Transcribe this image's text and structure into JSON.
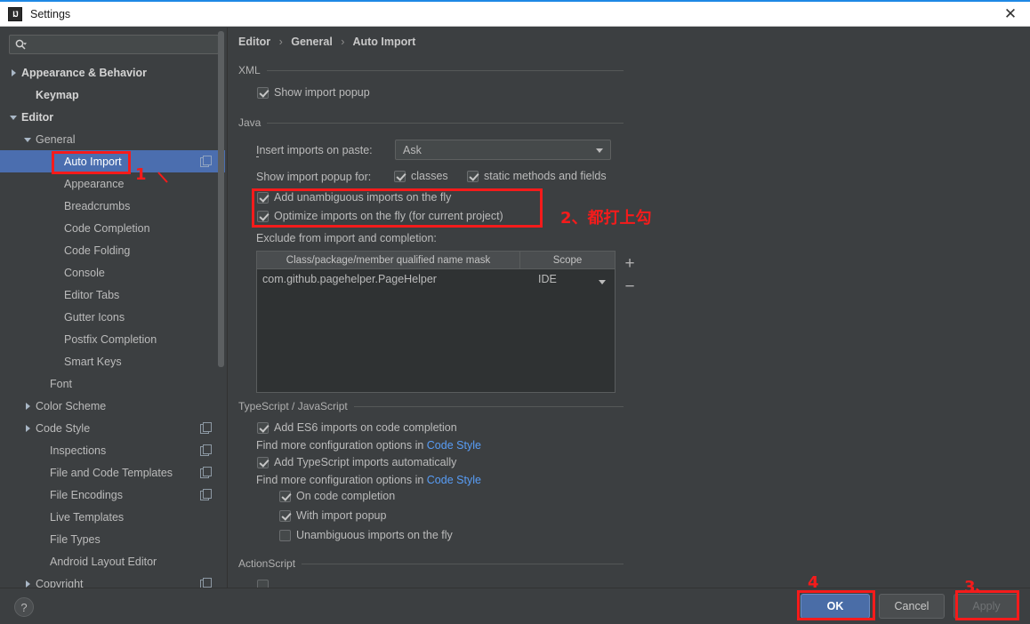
{
  "window": {
    "title": "Settings",
    "app_icon": "intellij-idea-icon",
    "close_label": "✕",
    "accent_color": "#1e88e5"
  },
  "sidebar": {
    "search": {
      "value": "",
      "placeholder": "",
      "icon": "search-icon"
    },
    "items": [
      {
        "label": "Appearance & Behavior",
        "indent": 0,
        "arrow": "right",
        "bold": true,
        "selected": false,
        "copy": false
      },
      {
        "label": "Keymap",
        "indent": 1,
        "arrow": "none",
        "bold": true,
        "selected": false,
        "copy": false
      },
      {
        "label": "Editor",
        "indent": 0,
        "arrow": "down",
        "bold": true,
        "selected": false,
        "copy": false
      },
      {
        "label": "General",
        "indent": 1,
        "arrow": "down",
        "bold": false,
        "selected": false,
        "copy": false
      },
      {
        "label": "Auto Import",
        "indent": 3,
        "arrow": "none",
        "bold": false,
        "selected": true,
        "copy": true
      },
      {
        "label": "Appearance",
        "indent": 3,
        "arrow": "none",
        "bold": false,
        "selected": false,
        "copy": false
      },
      {
        "label": "Breadcrumbs",
        "indent": 3,
        "arrow": "none",
        "bold": false,
        "selected": false,
        "copy": false
      },
      {
        "label": "Code Completion",
        "indent": 3,
        "arrow": "none",
        "bold": false,
        "selected": false,
        "copy": false
      },
      {
        "label": "Code Folding",
        "indent": 3,
        "arrow": "none",
        "bold": false,
        "selected": false,
        "copy": false
      },
      {
        "label": "Console",
        "indent": 3,
        "arrow": "none",
        "bold": false,
        "selected": false,
        "copy": false
      },
      {
        "label": "Editor Tabs",
        "indent": 3,
        "arrow": "none",
        "bold": false,
        "selected": false,
        "copy": false
      },
      {
        "label": "Gutter Icons",
        "indent": 3,
        "arrow": "none",
        "bold": false,
        "selected": false,
        "copy": false
      },
      {
        "label": "Postfix Completion",
        "indent": 3,
        "arrow": "none",
        "bold": false,
        "selected": false,
        "copy": false
      },
      {
        "label": "Smart Keys",
        "indent": 3,
        "arrow": "none",
        "bold": false,
        "selected": false,
        "copy": false
      },
      {
        "label": "Font",
        "indent": 2,
        "arrow": "none",
        "bold": false,
        "selected": false,
        "copy": false
      },
      {
        "label": "Color Scheme",
        "indent": 1,
        "arrow": "right",
        "bold": false,
        "selected": false,
        "copy": false
      },
      {
        "label": "Code Style",
        "indent": 1,
        "arrow": "right",
        "bold": false,
        "selected": false,
        "copy": true
      },
      {
        "label": "Inspections",
        "indent": 2,
        "arrow": "none",
        "bold": false,
        "selected": false,
        "copy": true
      },
      {
        "label": "File and Code Templates",
        "indent": 2,
        "arrow": "none",
        "bold": false,
        "selected": false,
        "copy": true
      },
      {
        "label": "File Encodings",
        "indent": 2,
        "arrow": "none",
        "bold": false,
        "selected": false,
        "copy": true
      },
      {
        "label": "Live Templates",
        "indent": 2,
        "arrow": "none",
        "bold": false,
        "selected": false,
        "copy": false
      },
      {
        "label": "File Types",
        "indent": 2,
        "arrow": "none",
        "bold": false,
        "selected": false,
        "copy": false
      },
      {
        "label": "Android Layout Editor",
        "indent": 2,
        "arrow": "none",
        "bold": false,
        "selected": false,
        "copy": false
      },
      {
        "label": "Copyright",
        "indent": 1,
        "arrow": "right",
        "bold": false,
        "selected": false,
        "copy": true
      }
    ]
  },
  "breadcrumb": {
    "part1": "Editor",
    "part2": "General",
    "part3": "Auto Import",
    "separator": "›"
  },
  "xml_section": {
    "title": "XML",
    "show_import_popup": {
      "label": "Show import popup",
      "checked": true
    }
  },
  "java_section": {
    "title": "Java",
    "insert_imports_label": "Insert imports on paste:",
    "insert_imports_value": "Ask",
    "show_popup_for_label": "Show import popup for:",
    "classes": {
      "label": "classes",
      "checked": true
    },
    "static_methods": {
      "label": "static methods and fields",
      "checked": true
    },
    "add_unambiguous": {
      "label": "Add unambiguous imports on the fly",
      "checked": true
    },
    "optimize_imports": {
      "label": "Optimize imports on the fly (for current project)",
      "checked": true
    },
    "exclude_label": "Exclude from import and completion:",
    "table": {
      "headers": [
        "Class/package/member qualified name mask",
        "Scope"
      ],
      "rows": [
        {
          "mask": "com.github.pagehelper.PageHelper",
          "scope": "IDE"
        }
      ],
      "add_button": "+",
      "remove_button": "−"
    }
  },
  "ts_section": {
    "title": "TypeScript / JavaScript",
    "add_es6": {
      "label": "Add ES6 imports on code completion",
      "checked": true
    },
    "hint1_prefix": "Find more configuration options in ",
    "hint1_link": "Code Style",
    "add_ts": {
      "label": "Add TypeScript imports automatically",
      "checked": true
    },
    "hint2_prefix": "Find more configuration options in ",
    "hint2_link": "Code Style",
    "on_code_completion": {
      "label": "On code completion",
      "checked": true
    },
    "with_import_popup": {
      "label": "With import popup",
      "checked": true
    },
    "unambiguous_fly": {
      "label": "Unambiguous imports on the fly",
      "checked": false
    }
  },
  "actionscript_section": {
    "title": "ActionScript"
  },
  "footer": {
    "help": "?",
    "ok": "OK",
    "cancel": "Cancel",
    "apply": "Apply"
  },
  "annotations": {
    "color": "#f51b1b",
    "marker1": "1",
    "marker2": "2、都打上勾",
    "marker3": "3、",
    "marker4": "4"
  }
}
